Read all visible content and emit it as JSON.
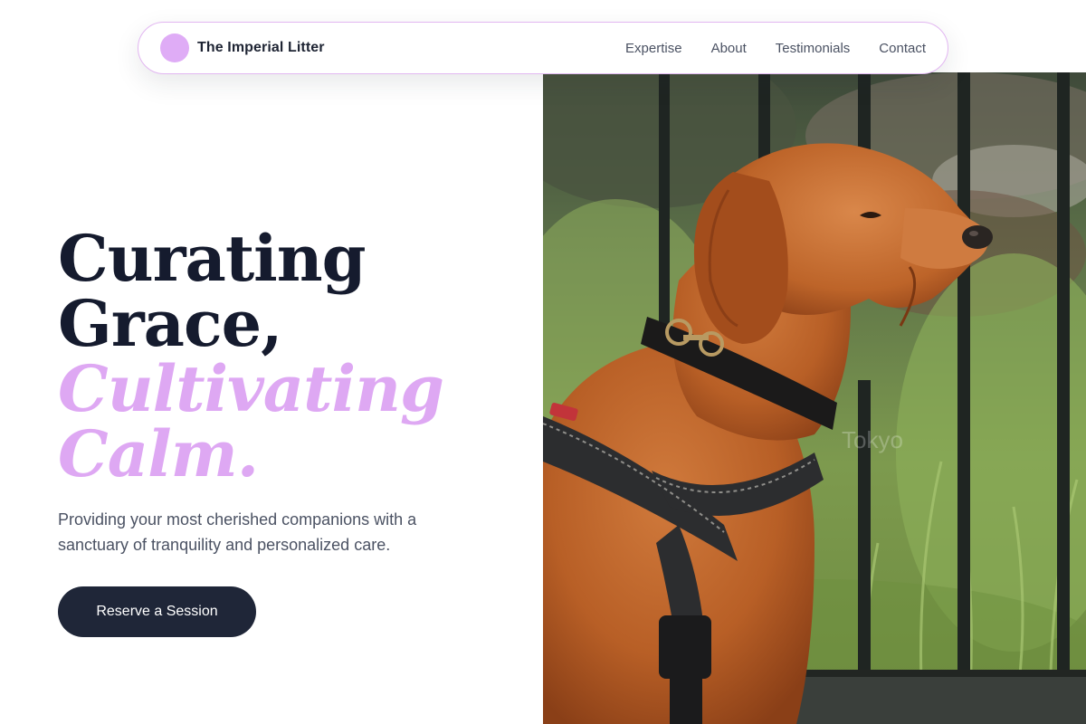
{
  "brand": {
    "name": "The Imperial Litter",
    "logo_icon": "circle-logo-icon",
    "logo_color": "#dfacf6"
  },
  "nav": {
    "links": [
      "Expertise",
      "About",
      "Testimonials",
      "Contact"
    ]
  },
  "hero": {
    "headline": {
      "line1": "Curating",
      "line2": "Grace,",
      "line3": "Cultivating",
      "line4": "Calm."
    },
    "subtitle": "Providing your most cherished companions with a sanctuary of tranquility and personalized care.",
    "cta_label": "Reserve a Session",
    "image": {
      "subject": "dog-photo",
      "watermark": "Tokyo"
    }
  },
  "colors": {
    "accent": "#dea8f3",
    "dark": "#151b2e",
    "button": "#1f2638",
    "muted_text": "#4b5263"
  }
}
